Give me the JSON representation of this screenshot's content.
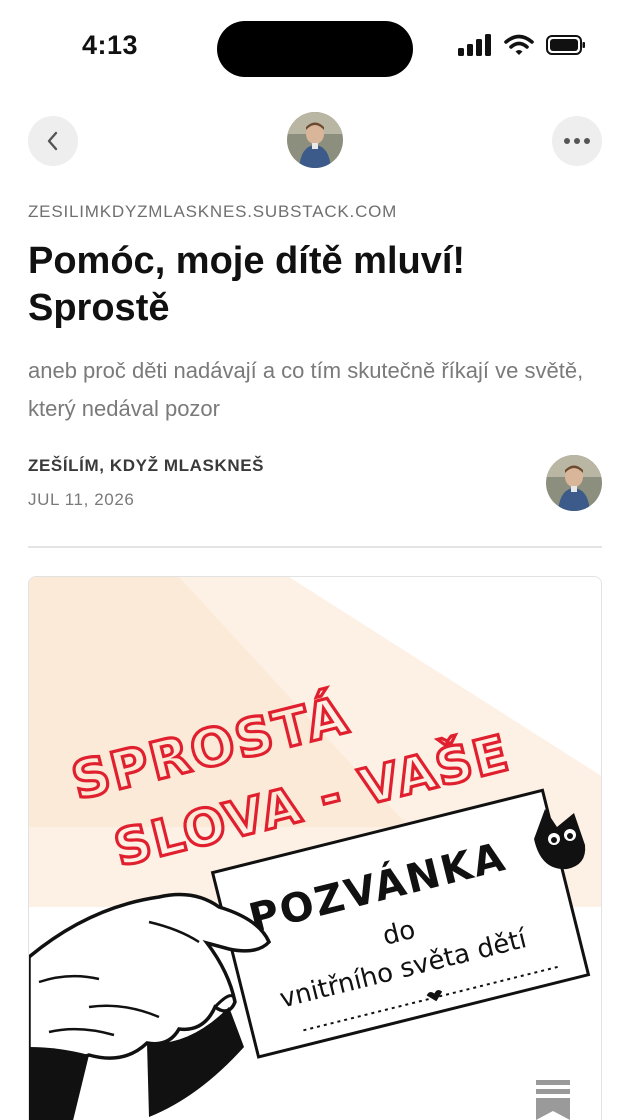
{
  "status_bar": {
    "time": "4:13",
    "icons": [
      "signal-icon",
      "wifi-icon",
      "battery-icon"
    ]
  },
  "nav": {
    "back_icon": "chevron-left-icon",
    "more_icon": "more-horizontal-icon"
  },
  "post": {
    "publication": "ZESILIMKDYZMLASKNES.SUBSTACK.COM",
    "title": "Pomóc, moje dítě mluví! Sprostě",
    "subtitle": "aneb proč děti nadávají a co tím skutečně říkají ve světě, který nedával pozor",
    "author": "ZEŠÍLÍM, KDYŽ MLASKNEŠ",
    "date": "JUL 11, 2026"
  },
  "cover_image": {
    "headline_line1": "SPROSTÁ",
    "headline_line2": "SLOVA - VAŠE",
    "card_title": "POZVÁNKA",
    "card_line1": "do",
    "card_line2": "vnitřního světa dětí"
  },
  "colors": {
    "headline_red": "#e0202e",
    "accent_bg": "#fdf0e4"
  }
}
